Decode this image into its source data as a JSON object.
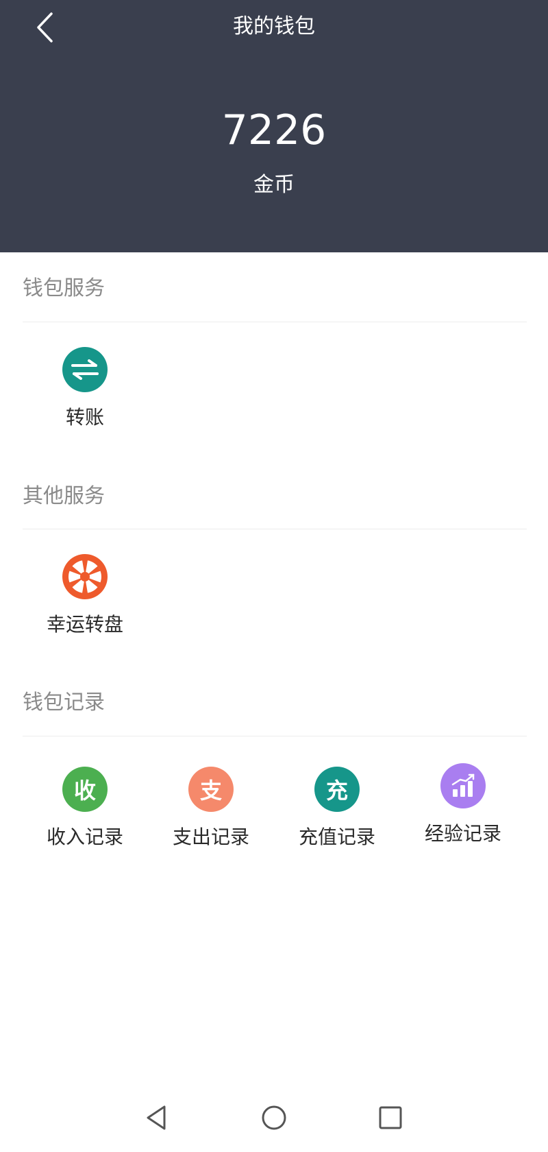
{
  "theme": {
    "header_bg": "#3a3f4e",
    "transfer_color": "#16968a",
    "wheel_color": "#ee5a2c",
    "income_color": "#4caf50",
    "expense_color": "#f5896b",
    "recharge_color": "#16968a",
    "exp_color": "#a97ef0"
  },
  "header": {
    "back_icon": "chevron-left-icon",
    "title": "我的钱包"
  },
  "wallet": {
    "balance": "7226",
    "unit": "金币"
  },
  "sections": {
    "wallet_services": {
      "title": "钱包服务",
      "items": [
        {
          "label": "转账",
          "icon": "transfer-arrows-icon"
        }
      ]
    },
    "other_services": {
      "title": "其他服务",
      "items": [
        {
          "label": "幸运转盘",
          "icon": "lucky-wheel-icon"
        }
      ]
    },
    "wallet_records": {
      "title": "钱包记录",
      "items": [
        {
          "label": "收入记录",
          "icon_text": "收"
        },
        {
          "label": "支出记录",
          "icon_text": "支"
        },
        {
          "label": "充值记录",
          "icon_text": "充"
        },
        {
          "label": "经验记录",
          "icon": "bar-chart-icon"
        }
      ]
    }
  },
  "navbar": {
    "back": "nav-back-icon",
    "home": "nav-home-icon",
    "recents": "nav-recents-icon"
  }
}
